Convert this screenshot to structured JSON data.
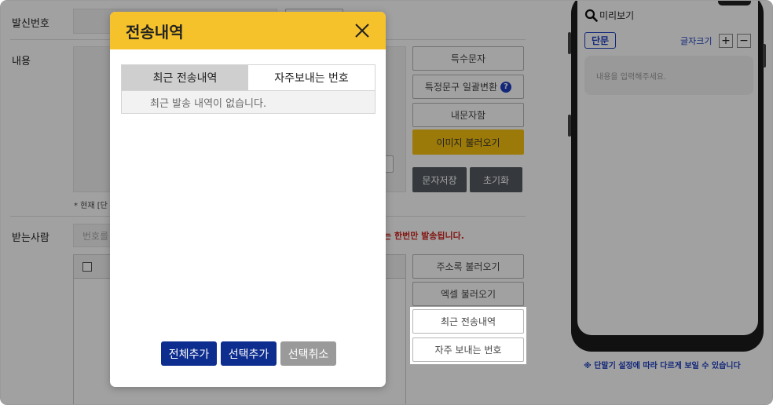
{
  "form": {
    "sender_label": "발신번호",
    "content_label": "내용",
    "receiver_label": "받는사람",
    "receiver_placeholder": "번호를",
    "notice_text": "는 한번만 발송됩니다.",
    "current_hint": "* 현재 [단"
  },
  "side_buttons": {
    "special_chars": "특수문자",
    "bulk_convert": "특정문구 일괄변환",
    "help_icon_glyph": "?",
    "inner_chars": "내문자함",
    "load_image": "이미지 불러오기",
    "save_message": "문자저장",
    "reset": "초기화",
    "load_address": "주소록 불러오기",
    "load_excel": "엑셀 불러오기",
    "recent_history": "최근 전송내역",
    "frequent_numbers": "자주 보내는 번호"
  },
  "preview": {
    "title": "미리보기",
    "type_badge": "단문",
    "font_size_label": "글자크기",
    "plus": "+",
    "minus": "−",
    "placeholder": "내용을 입력해주세요.",
    "disclaimer": "※ 단말기 설정에 따라 다르게 보일 수 있습니다"
  },
  "modal": {
    "title": "전송내역",
    "close_glyph": "✕",
    "tabs": [
      "최근 전송내역",
      "자주보내는 번호"
    ],
    "empty_message": "최근 발송 내역이 없습니다.",
    "buttons": {
      "add_all": "전체추가",
      "add_selected": "선택추가",
      "cancel_selected": "선택취소"
    }
  },
  "colors": {
    "modal_header": "#f6c22b",
    "navy_button": "#0d2d8f",
    "gray_button": "#9a9a9a",
    "accent_blue": "#1d3ec0",
    "notice_red": "#d0251f",
    "image_button": "#f7c10f"
  }
}
